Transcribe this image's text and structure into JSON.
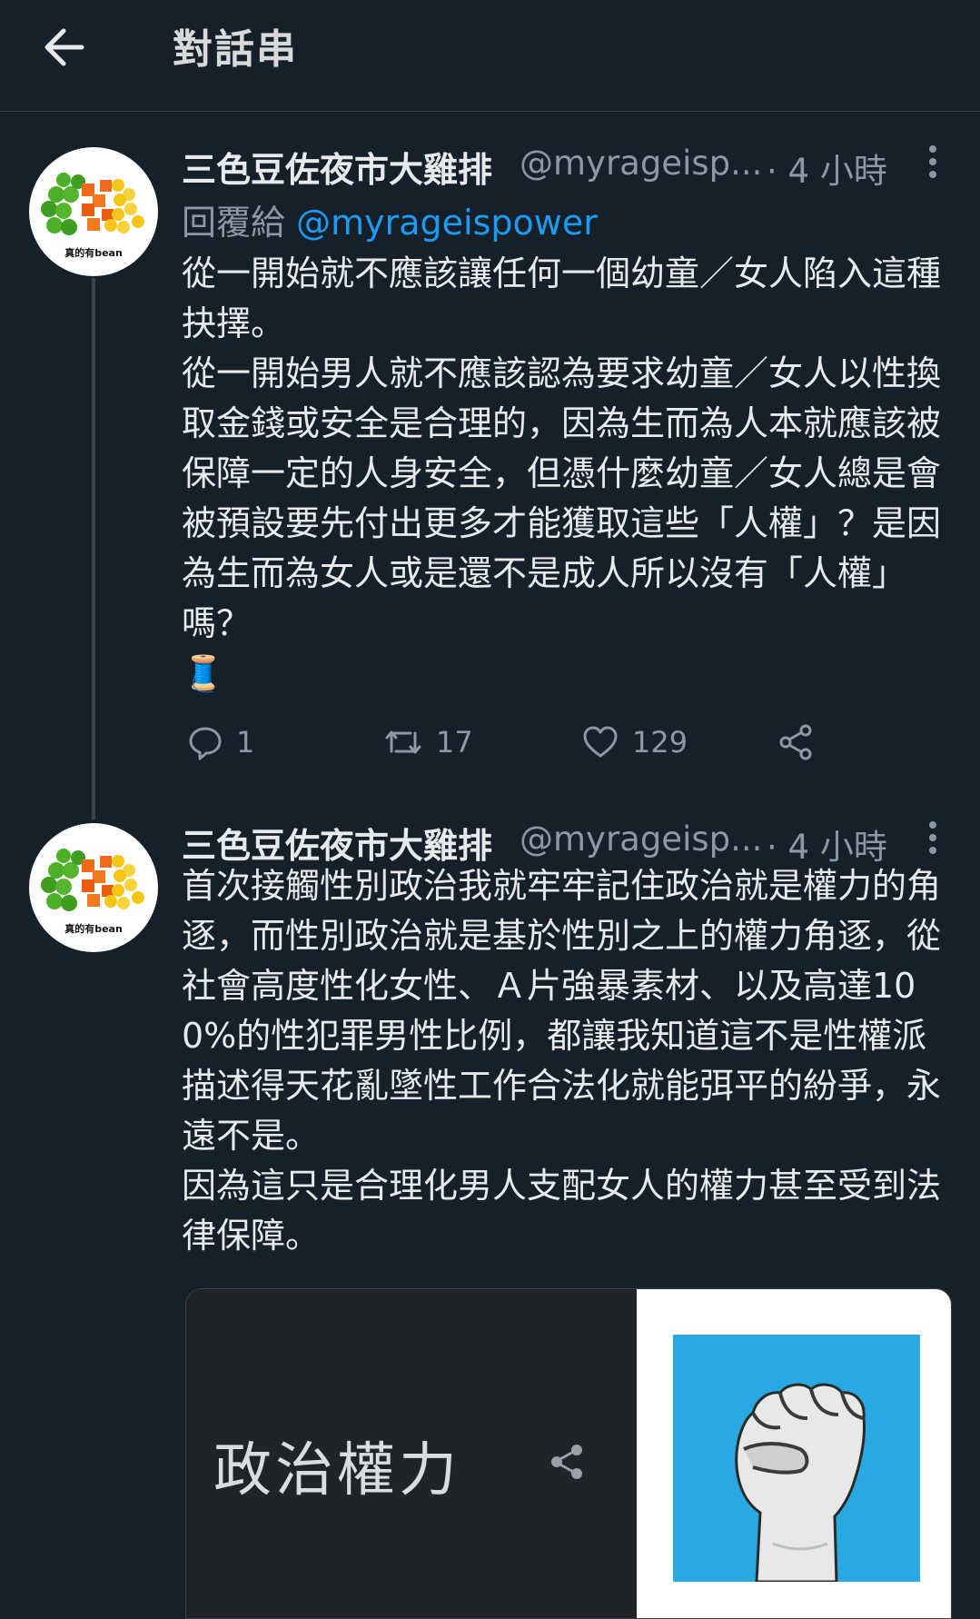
{
  "header": {
    "title": "對話串"
  },
  "tweets": [
    {
      "author_name": "三色豆佐夜市大雞排",
      "handle": "@myrageisp...",
      "time": "· 4 小時",
      "avatar_caption": "真的有bean",
      "reply_prefix": "回覆給 ",
      "reply_mention": "@myrageispower",
      "text": "從一開始就不應該讓任何一個幼童／女人陷入這種抉擇。\n從一開始男人就不應該認為要求幼童／女人以性換取金錢或安全是合理的，因為生而為人本就應該被保障一定的人身安全，但憑什麼幼童／女人總是會被預設要先付出更多才能獲取這些「人權」？是因為生而為女人或是還不是成人所以沒有「人權」嗎？",
      "emoji": "🧵",
      "stats": {
        "replies": "1",
        "retweets": "17",
        "likes": "129"
      }
    },
    {
      "author_name": "三色豆佐夜市大雞排",
      "handle": "@myrageisp...",
      "time": "· 4 小時",
      "avatar_caption": "真的有bean",
      "text": "首次接觸性別政治我就牢牢記住政治就是權力的角逐，而性別政治就是基於性別之上的權力角逐，從社會高度性化女性、Ａ片強暴素材、以及高達100%的性犯罪男性比例，都讓我知道這不是性權派描述得天花亂墜性工作合法化就能弭平的紛爭，永遠不是。\n因為這只是合理化男人支配女人的權力甚至受到法律保障。",
      "card": {
        "title": "政治權力"
      }
    }
  ],
  "colors": {
    "background": "#15202b",
    "accent": "#1d9bf0",
    "muted": "#8b98a5",
    "text": "#e7e9ea"
  }
}
